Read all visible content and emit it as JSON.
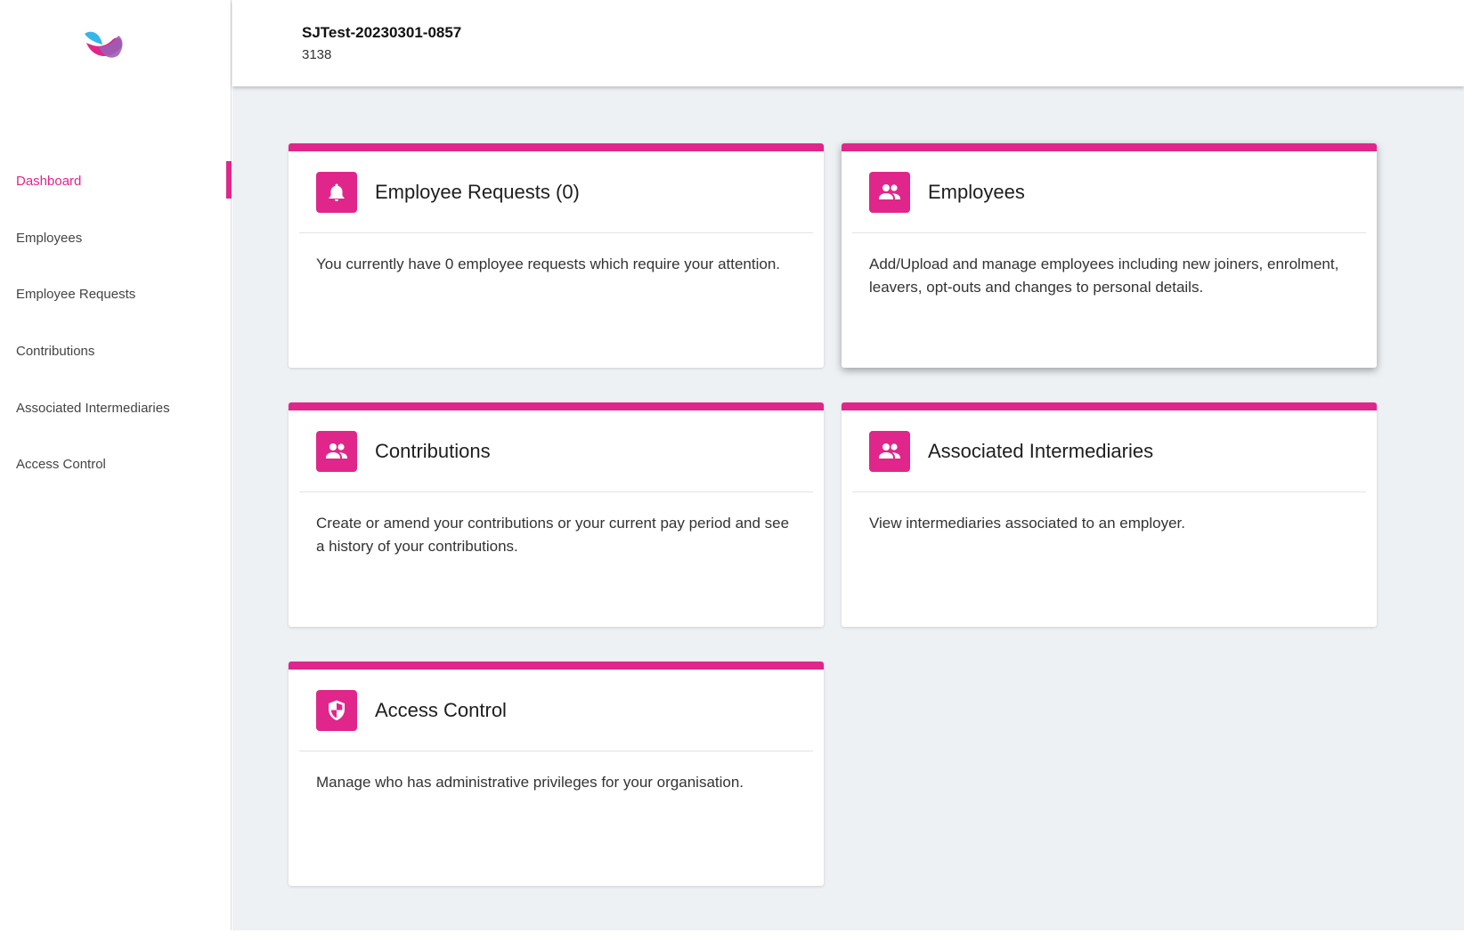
{
  "header": {
    "title": "SJTest-20230301-0857",
    "subtitle": "3138"
  },
  "sidebar": {
    "items": [
      {
        "label": "Dashboard",
        "active": true
      },
      {
        "label": "Employees"
      },
      {
        "label": "Employee Requests"
      },
      {
        "label": "Contributions"
      },
      {
        "label": "Associated Intermediaries"
      },
      {
        "label": "Access Control"
      }
    ]
  },
  "cards": [
    {
      "title": "Employee Requests (0)",
      "body": "You currently have 0 employee requests which require your attention.",
      "icon": "bell-icon"
    },
    {
      "title": "Employees",
      "body": "Add/Upload and manage employees including new joiners, enrolment, leavers, opt-outs and changes to personal details.",
      "icon": "people-icon"
    },
    {
      "title": "Contributions",
      "body": "Create or amend your contributions or your current pay period and see a history of your contributions.",
      "icon": "people-icon"
    },
    {
      "title": "Associated Intermediaries",
      "body": "View intermediaries associated to an employer.",
      "icon": "people-icon"
    },
    {
      "title": "Access Control",
      "body": "Manage who has administrative privileges for your organisation.",
      "icon": "shield-icon"
    }
  ],
  "colors": {
    "accent": "#e0268a",
    "background": "#eef1f4",
    "logo_blue": "#35b6e8",
    "logo_pink": "#e0268a",
    "logo_purple": "#9b5fb5"
  }
}
